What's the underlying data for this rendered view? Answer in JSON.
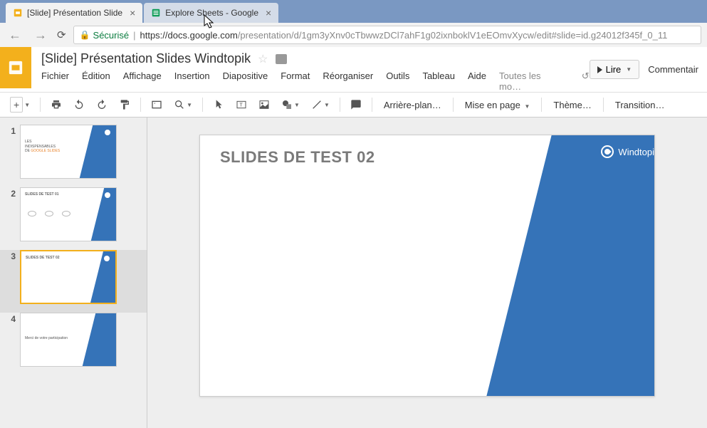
{
  "browser": {
    "tabs": [
      {
        "title": "[Slide] Présentation Slide",
        "icon_color": "#f3b01c"
      },
      {
        "title": "Explore Sheets - Google",
        "icon_color": "#0f9d58"
      }
    ],
    "secure_label": "Sécurisé",
    "url_host": "https://docs.google.com",
    "url_path": "/presentation/d/1gm3yXnv0cTbwwzDCl7ahF1g02ixnboklV1eEOmvXycw/edit#slide=id.g24012f345f_0_11"
  },
  "app": {
    "doc_title": "[Slide] Présentation Slides Windtopik",
    "menus": [
      "Fichier",
      "Édition",
      "Affichage",
      "Insertion",
      "Diapositive",
      "Format",
      "Réorganiser",
      "Outils",
      "Tableau",
      "Aide"
    ],
    "menu_extra": "Toutes les mo…",
    "present_label": "Lire",
    "comment_label": "Commentair"
  },
  "toolbar": {
    "bg_label": "Arrière-plan…",
    "layout_label": "Mise en page",
    "theme_label": "Thème…",
    "transition_label": "Transition…"
  },
  "thumbnails": {
    "items": [
      {
        "num": "1",
        "title_line1": "LES",
        "title_line2": "INDISPENSABLES",
        "title_line3_prefix": "DE ",
        "title_line3_highlight": "GOOGLE SLIDES"
      },
      {
        "num": "2",
        "title": "SLIDES DE TEST 01"
      },
      {
        "num": "3",
        "title": "SLIDES DE TEST 02",
        "selected": true
      },
      {
        "num": "4",
        "title": "Merci de votre participation"
      }
    ]
  },
  "slide": {
    "title": "SLIDES DE TEST 02",
    "brand": "Windtopi"
  }
}
